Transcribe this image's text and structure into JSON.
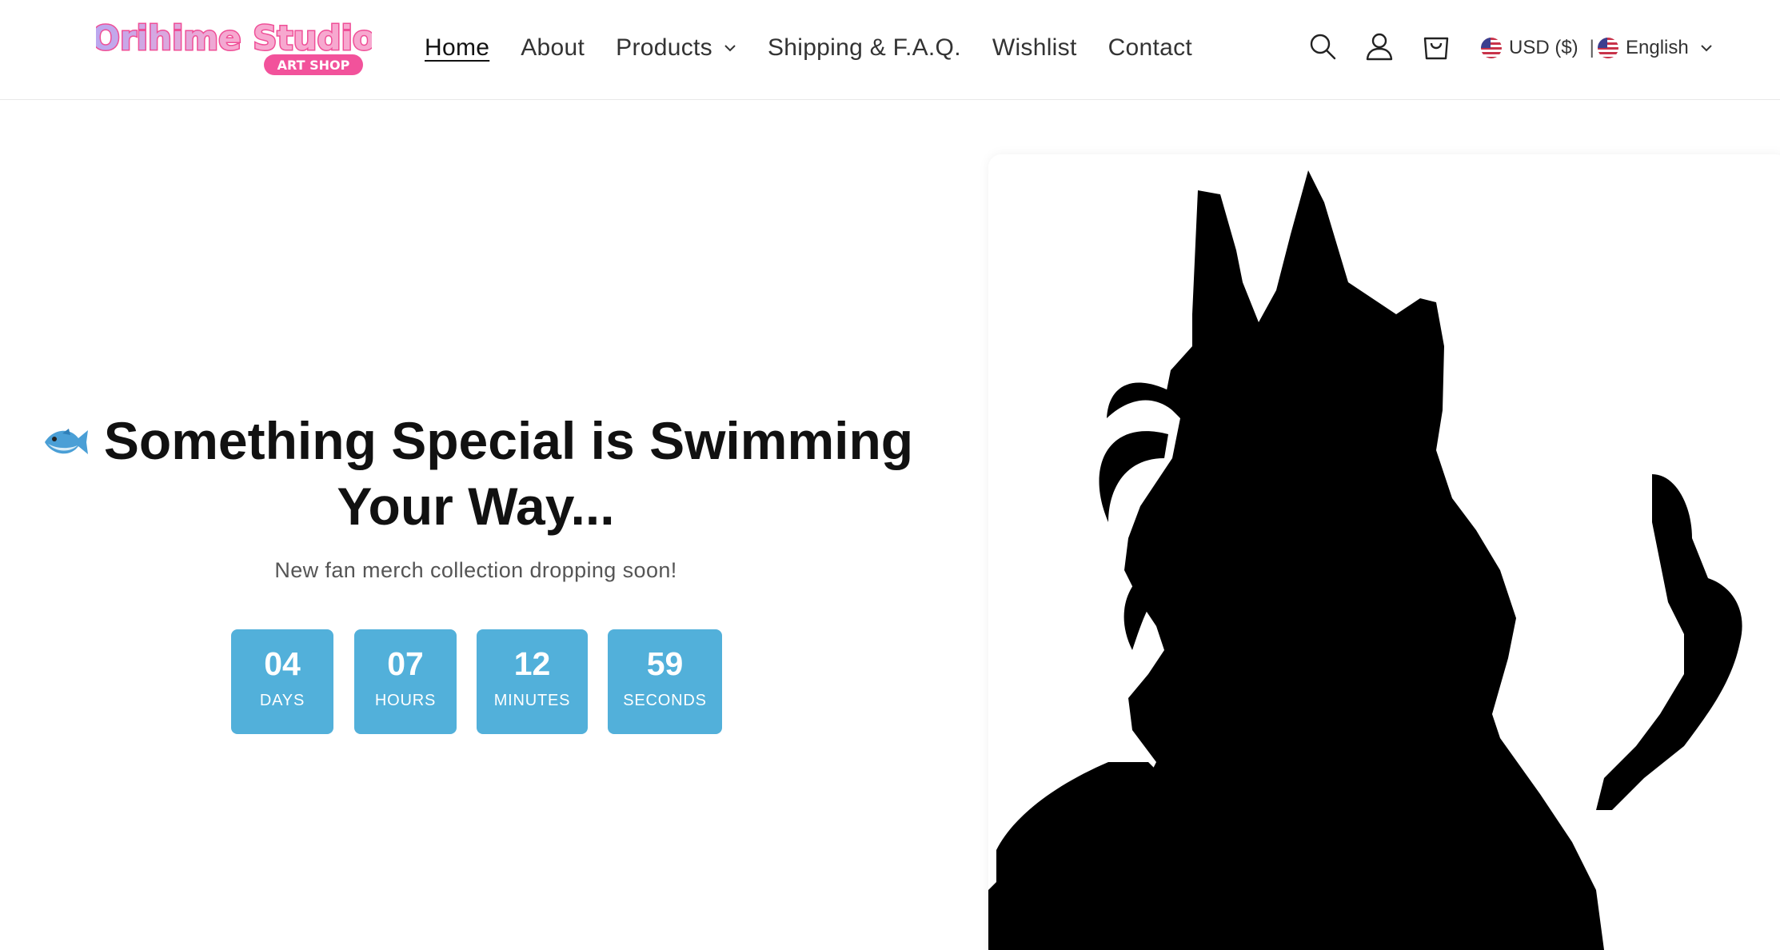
{
  "header": {
    "logo": {
      "title": "Orihime Studio",
      "subtitle": "ART SHOP",
      "colors": {
        "pink": "#f2529b",
        "lavender": "#b9a7f0",
        "outline": "#ef4f97"
      }
    },
    "nav": [
      {
        "label": "Home",
        "active": true
      },
      {
        "label": "About"
      },
      {
        "label": "Products",
        "has_dropdown": true
      },
      {
        "label": "Shipping & F.A.Q."
      },
      {
        "label": "Wishlist"
      },
      {
        "label": "Contact"
      }
    ],
    "icons": [
      "search-icon",
      "account-icon",
      "cart-icon"
    ],
    "currency": "USD ($)",
    "language": "English",
    "separator": "|"
  },
  "hero": {
    "headline_emoji": "fish-icon",
    "headline": "Something Special is Swimming Your Way...",
    "subtext": "New fan merch collection dropping soon!",
    "countdown": [
      {
        "value": "04",
        "label": "DAYS"
      },
      {
        "value": "07",
        "label": "HOURS"
      },
      {
        "value": "12",
        "label": "MINUTES"
      },
      {
        "value": "59",
        "label": "SECONDS"
      }
    ],
    "countdown_color": "#52b0da",
    "image": "silhouette-image"
  }
}
